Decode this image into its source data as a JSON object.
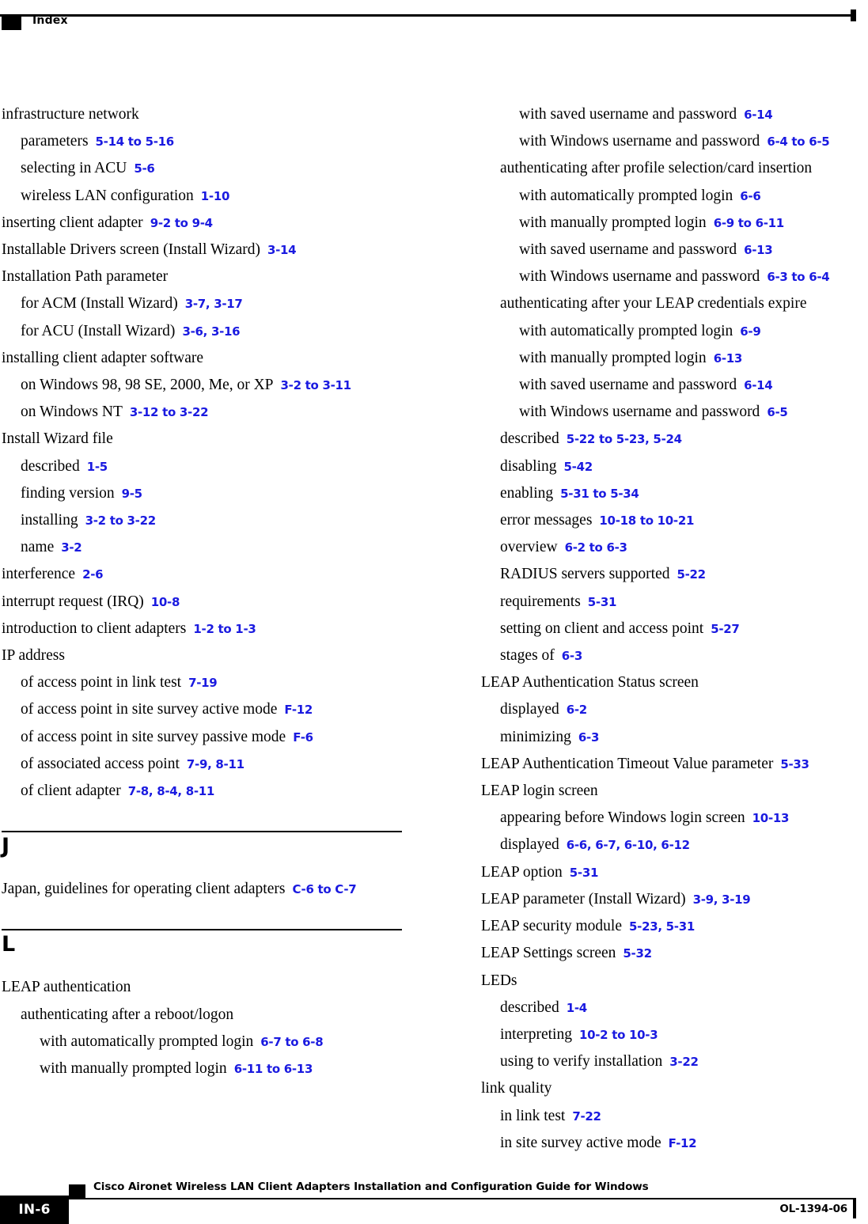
{
  "header": {
    "title": "Index"
  },
  "colors": {
    "page_reference": "#1a1ae0",
    "text": "#000000",
    "rule": "#000000"
  },
  "columns": {
    "left": {
      "entries": [
        {
          "level": 0,
          "text": "infrastructure network",
          "refs": ""
        },
        {
          "level": 1,
          "text": "parameters",
          "refs": "5-14 to 5-16"
        },
        {
          "level": 1,
          "text": "selecting in ACU",
          "refs": "5-6"
        },
        {
          "level": 1,
          "text": "wireless LAN configuration",
          "refs": "1-10"
        },
        {
          "level": 0,
          "text": "inserting client adapter",
          "refs": "9-2 to 9-4"
        },
        {
          "level": 0,
          "text": "Installable Drivers screen (Install Wizard)",
          "refs": "3-14"
        },
        {
          "level": 0,
          "text": "Installation Path parameter",
          "refs": ""
        },
        {
          "level": 1,
          "text": "for ACM (Install Wizard)",
          "refs": "3-7, 3-17"
        },
        {
          "level": 1,
          "text": "for ACU (Install Wizard)",
          "refs": "3-6, 3-16"
        },
        {
          "level": 0,
          "text": "installing client adapter software",
          "refs": ""
        },
        {
          "level": 1,
          "text": "on Windows 98, 98 SE, 2000, Me, or XP",
          "refs": "3-2 to 3-11"
        },
        {
          "level": 1,
          "text": "on Windows NT",
          "refs": "3-12 to 3-22"
        },
        {
          "level": 0,
          "text": "Install Wizard file",
          "refs": ""
        },
        {
          "level": 1,
          "text": "described",
          "refs": "1-5"
        },
        {
          "level": 1,
          "text": "finding version",
          "refs": "9-5"
        },
        {
          "level": 1,
          "text": "installing",
          "refs": "3-2 to 3-22"
        },
        {
          "level": 1,
          "text": "name",
          "refs": "3-2"
        },
        {
          "level": 0,
          "text": "interference",
          "refs": "2-6"
        },
        {
          "level": 0,
          "text": "interrupt request (IRQ)",
          "refs": "10-8"
        },
        {
          "level": 0,
          "text": "introduction to client adapters",
          "refs": "1-2 to 1-3"
        },
        {
          "level": 0,
          "text": "IP address",
          "refs": ""
        },
        {
          "level": 1,
          "text": "of access point in link test",
          "refs": "7-19"
        },
        {
          "level": 1,
          "text": "of access point in site survey active mode",
          "refs": "F-12"
        },
        {
          "level": 1,
          "text": "of access point in site survey passive mode",
          "refs": "F-6"
        },
        {
          "level": 1,
          "text": "of associated access point",
          "refs": "7-9, 8-11"
        },
        {
          "level": 1,
          "text": "of client adapter",
          "refs": "7-8, 8-4, 8-11"
        }
      ],
      "sections": [
        {
          "letter": "J",
          "entries": [
            {
              "level": 0,
              "text": "Japan, guidelines for operating client adapters",
              "refs": "C-6 to C-7"
            }
          ]
        },
        {
          "letter": "L",
          "entries": [
            {
              "level": 0,
              "text": "LEAP authentication",
              "refs": ""
            },
            {
              "level": 1,
              "text": "authenticating after a reboot/logon",
              "refs": ""
            },
            {
              "level": 2,
              "text": "with automatically prompted login",
              "refs": "6-7 to 6-8"
            },
            {
              "level": 2,
              "text": "with manually prompted login",
              "refs": "6-11 to 6-13"
            }
          ]
        }
      ]
    },
    "right": {
      "entries": [
        {
          "level": 2,
          "text": "with saved username and password",
          "refs": "6-14"
        },
        {
          "level": 2,
          "text": "with Windows username and password",
          "refs": "6-4 to 6-5"
        },
        {
          "level": 1,
          "text": "authenticating after profile selection/card insertion",
          "refs": ""
        },
        {
          "level": 2,
          "text": "with automatically prompted login",
          "refs": "6-6"
        },
        {
          "level": 2,
          "text": "with manually prompted login",
          "refs": "6-9 to 6-11"
        },
        {
          "level": 2,
          "text": "with saved username and password",
          "refs": "6-13"
        },
        {
          "level": 2,
          "text": "with Windows username and password",
          "refs": "6-3 to 6-4"
        },
        {
          "level": 1,
          "text": "authenticating after your LEAP credentials expire",
          "refs": ""
        },
        {
          "level": 2,
          "text": "with automatically prompted login",
          "refs": "6-9"
        },
        {
          "level": 2,
          "text": "with manually prompted login",
          "refs": "6-13"
        },
        {
          "level": 2,
          "text": "with saved username and password",
          "refs": "6-14"
        },
        {
          "level": 2,
          "text": "with Windows username and password",
          "refs": "6-5"
        },
        {
          "level": 1,
          "text": "described",
          "refs": "5-22 to 5-23, 5-24"
        },
        {
          "level": 1,
          "text": "disabling",
          "refs": "5-42"
        },
        {
          "level": 1,
          "text": "enabling",
          "refs": "5-31 to 5-34"
        },
        {
          "level": 1,
          "text": "error messages",
          "refs": "10-18 to 10-21"
        },
        {
          "level": 1,
          "text": "overview",
          "refs": "6-2 to 6-3"
        },
        {
          "level": 1,
          "text": "RADIUS servers supported",
          "refs": "5-22"
        },
        {
          "level": 1,
          "text": "requirements",
          "refs": "5-31"
        },
        {
          "level": 1,
          "text": "setting on client and access point",
          "refs": "5-27"
        },
        {
          "level": 1,
          "text": "stages of",
          "refs": "6-3"
        },
        {
          "level": 0,
          "text": "LEAP Authentication Status screen",
          "refs": ""
        },
        {
          "level": 1,
          "text": "displayed",
          "refs": "6-2"
        },
        {
          "level": 1,
          "text": "minimizing",
          "refs": "6-3"
        },
        {
          "level": 0,
          "text": "LEAP Authentication Timeout Value parameter",
          "refs": "5-33"
        },
        {
          "level": 0,
          "text": "LEAP login screen",
          "refs": ""
        },
        {
          "level": 1,
          "text": "appearing before Windows login screen",
          "refs": "10-13"
        },
        {
          "level": 1,
          "text": "displayed",
          "refs": "6-6, 6-7, 6-10, 6-12"
        },
        {
          "level": 0,
          "text": "LEAP option",
          "refs": "5-31"
        },
        {
          "level": 0,
          "text": "LEAP parameter (Install Wizard)",
          "refs": "3-9, 3-19"
        },
        {
          "level": 0,
          "text": "LEAP security module",
          "refs": "5-23, 5-31"
        },
        {
          "level": 0,
          "text": "LEAP Settings screen",
          "refs": "5-32"
        },
        {
          "level": 0,
          "text": "LEDs",
          "refs": ""
        },
        {
          "level": 1,
          "text": "described",
          "refs": "1-4"
        },
        {
          "level": 1,
          "text": "interpreting",
          "refs": "10-2 to 10-3"
        },
        {
          "level": 1,
          "text": "using to verify installation",
          "refs": "3-22"
        },
        {
          "level": 0,
          "text": "link quality",
          "refs": ""
        },
        {
          "level": 1,
          "text": "in link test",
          "refs": "7-22"
        },
        {
          "level": 1,
          "text": "in site survey active mode",
          "refs": "F-12"
        }
      ],
      "sections": []
    }
  },
  "footer": {
    "page_number": "IN-6",
    "guide_title": "Cisco Aironet Wireless LAN Client Adapters Installation and Configuration Guide for Windows",
    "document_id": "OL-1394-06"
  }
}
